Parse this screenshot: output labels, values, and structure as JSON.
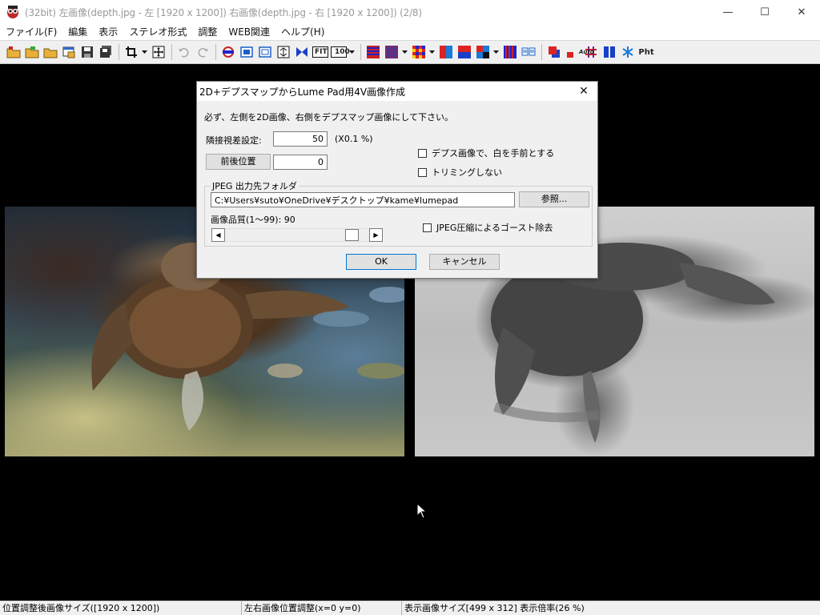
{
  "window": {
    "title": "(32bit) 左画像(depth.jpg - 左 [1920 x 1200]) 右画像(depth.jpg - 右 [1920 x 1200])  (2/8)",
    "controls": {
      "minimize": "—",
      "maximize": "☐",
      "close": "✕"
    }
  },
  "menu": {
    "items": [
      "ファイル(F)",
      "編集",
      "表示",
      "ステレオ形式",
      "調整",
      "WEB関連",
      "ヘルプ(H)"
    ]
  },
  "toolbar": {
    "fit_label": "FIT",
    "zoom100_label": "100",
    "auto_label": "Auto",
    "pht_label": "Pht"
  },
  "dialog": {
    "title": "2D+デプスマップからLume Pad用4V画像作成",
    "close": "✕",
    "instruction": "必ず、左側を2D画像、右側をデプスマップ画像にして下さい。",
    "parallax_label": "隣接視差設定:",
    "parallax_value": "50",
    "parallax_unit": "(X0.1 %)",
    "front_back_button": "前後位置",
    "front_back_value": "0",
    "depth_white_front": "デプス画像で、白を手前とする",
    "no_trimming": "トリミングしない",
    "group_label": "JPEG 出力先フォルダ",
    "folder_path": "C:¥Users¥suto¥OneDrive¥デスクトップ¥kame¥lumepad",
    "browse_button": "参照...",
    "quality_label": "画像品質(1〜99):  90",
    "quality_value": 90,
    "ghost_removal": "JPEG圧縮によるゴースト除去",
    "ok_button": "OK",
    "cancel_button": "キャンセル"
  },
  "status": {
    "pane1": "位置調整後画像サイズ([1920 x 1200])",
    "pane2": "左右画像位置調整(x=0 y=0)",
    "pane3": "表示画像サイズ[499 x 312]  表示倍率(26 %)"
  }
}
